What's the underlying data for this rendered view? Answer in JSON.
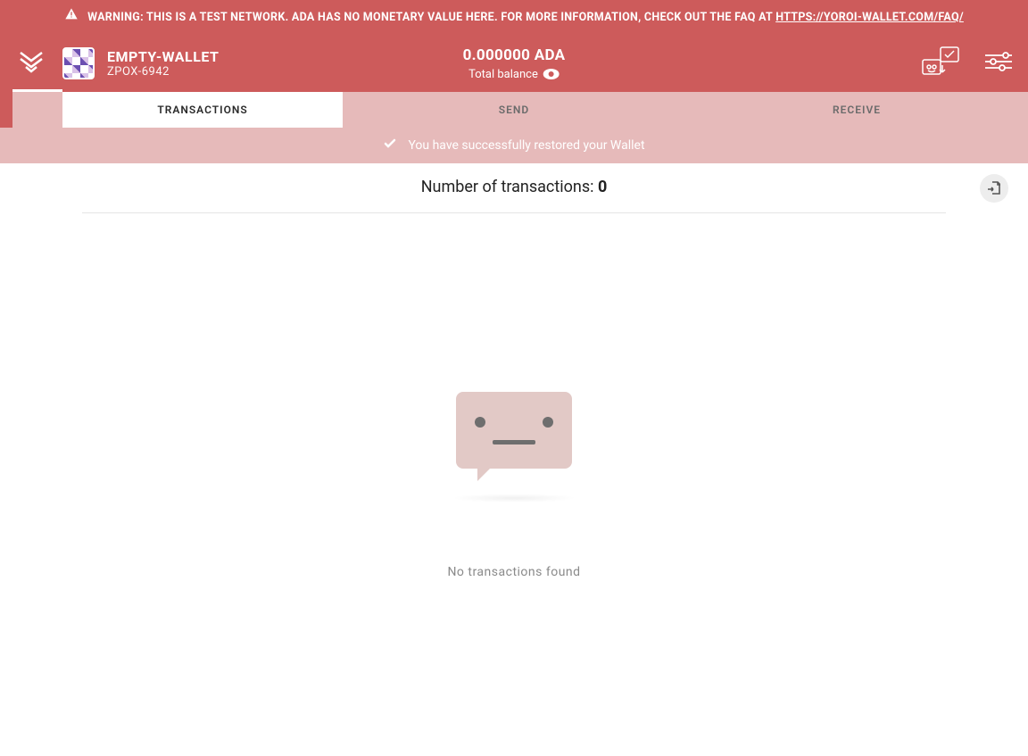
{
  "warning": {
    "prefix": "WARNING: THIS IS A TEST NETWORK. ADA HAS NO MONETARY VALUE HERE. FOR MORE INFORMATION, CHECK OUT THE FAQ AT ",
    "link_text": "HTTPS://YOROI-WALLET.COM/FAQ/"
  },
  "header": {
    "wallet_name": "EMPTY-WALLET",
    "wallet_code": "ZPOX-6942",
    "balance_amount": "0.000000 ADA",
    "balance_label": "Total balance"
  },
  "tabs": {
    "transactions": "TRANSACTIONS",
    "send": "SEND",
    "receive": "RECEIVE"
  },
  "success_banner": {
    "message": "You have successfully restored your Wallet"
  },
  "content": {
    "tx_count_label": "Number of transactions: ",
    "tx_count_value": "0",
    "empty_text": "No transactions found"
  }
}
